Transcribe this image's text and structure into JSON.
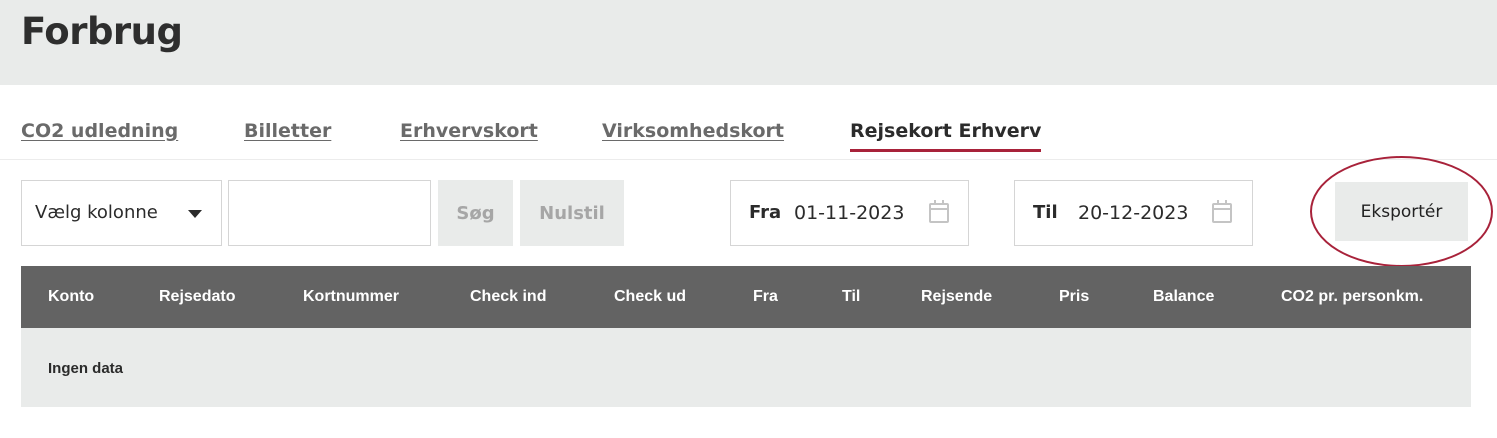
{
  "page": {
    "title": "Forbrug"
  },
  "tabs": [
    {
      "label": "CO2 udledning",
      "active": false
    },
    {
      "label": "Billetter",
      "active": false
    },
    {
      "label": "Erhvervskort",
      "active": false
    },
    {
      "label": "Virksomhedskort",
      "active": false
    },
    {
      "label": "Rejsekort Erhverv",
      "active": true
    }
  ],
  "filters": {
    "column_select": "Vælg kolonne",
    "search_value": "",
    "search_button": "Søg",
    "reset_button": "Nulstil",
    "from_label": "Fra",
    "from_date": "01-11-2023",
    "to_label": "Til",
    "to_date": "20-12-2023",
    "export_button": "Eksportér"
  },
  "table": {
    "columns": [
      "Konto",
      "Rejsedato",
      "Kortnummer",
      "Check ind",
      "Check ud",
      "Fra",
      "Til",
      "Rejsende",
      "Pris",
      "Balance",
      "CO2 pr. personkm."
    ],
    "empty_text": "Ingen data"
  },
  "colors": {
    "accent": "#a8223a",
    "header_bg": "#e9ebea",
    "table_header_bg": "#636363"
  },
  "icons": {
    "date_picker": "calendar-icon",
    "dropdown": "chevron-down-icon"
  }
}
